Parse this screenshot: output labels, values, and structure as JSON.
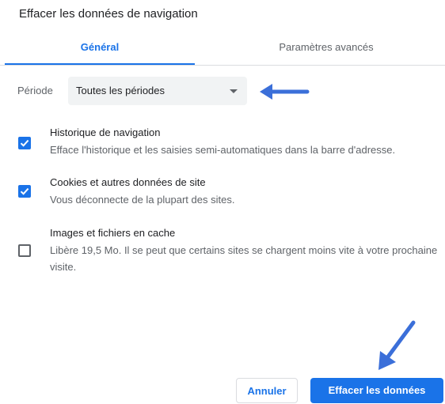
{
  "dialog": {
    "title": "Effacer les données de navigation"
  },
  "tabs": [
    {
      "label": "Général",
      "active": true
    },
    {
      "label": "Paramètres avancés",
      "active": false
    }
  ],
  "period": {
    "label": "Période",
    "value": "Toutes les périodes"
  },
  "options": [
    {
      "title": "Historique de navigation",
      "description": "Efface l'historique et les saisies semi-automatiques dans la barre d'adresse.",
      "checked": true
    },
    {
      "title": "Cookies et autres données de site",
      "description": "Vous déconnecte de la plupart des sites.",
      "checked": true
    },
    {
      "title": "Images et fichiers en cache",
      "description": "Libère 19,5 Mo. Il se peut que certains sites se chargent moins vite à votre prochaine visite.",
      "checked": false
    }
  ],
  "buttons": {
    "cancel": "Annuler",
    "clear": "Effacer les données"
  },
  "colors": {
    "accent": "#1a73e8",
    "annotation_arrow": "#3b6fd9"
  },
  "icons": [
    "check-icon",
    "dropdown-caret-icon",
    "annotation-arrow-icon"
  ]
}
